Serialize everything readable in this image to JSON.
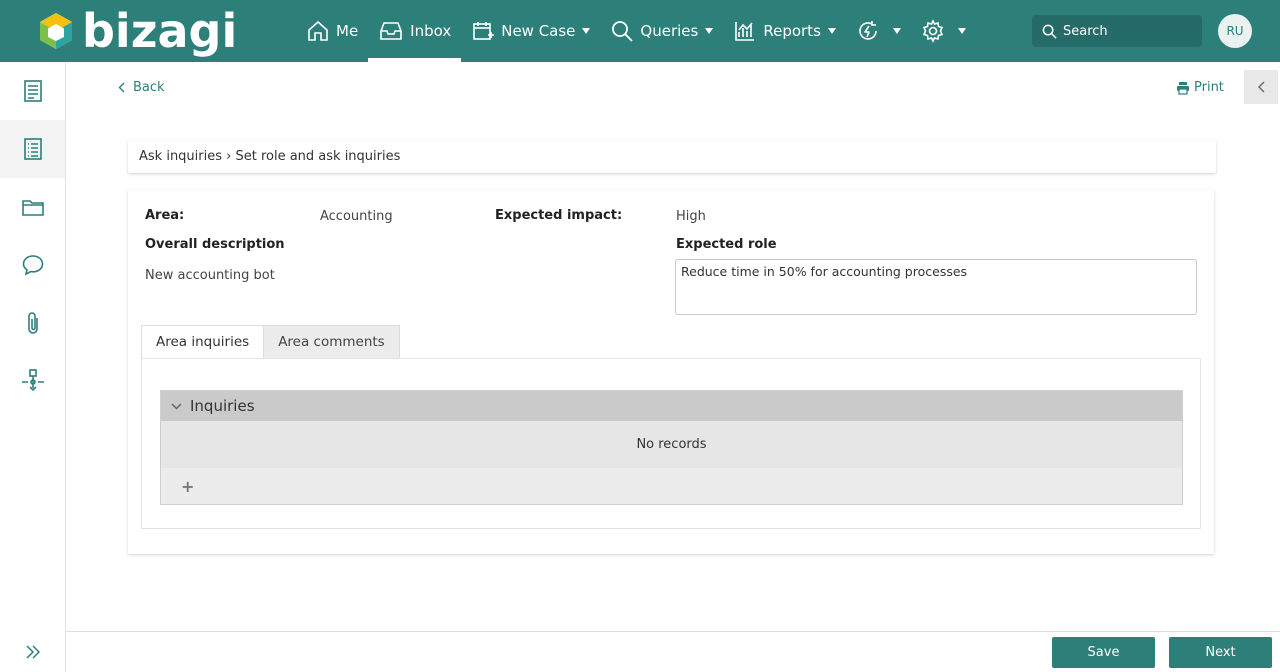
{
  "app": {
    "brand": "bizagi",
    "user_initials": "RU"
  },
  "nav": {
    "me": "Me",
    "inbox": "Inbox",
    "new_case": "New Case",
    "queries": "Queries",
    "reports": "Reports"
  },
  "search": {
    "placeholder": "Search"
  },
  "actions": {
    "back": "Back",
    "print": "Print"
  },
  "breadcrumb": "Ask inquiries › Set role and ask inquiries",
  "form": {
    "area_label": "Area:",
    "area_value": "Accounting",
    "impact_label": "Expected impact:",
    "impact_value": "High",
    "desc_label": "Overall description",
    "desc_value": "New accounting bot",
    "role_label": "Expected role",
    "role_value": "Reduce time in 50% for accounting processes"
  },
  "tabs": {
    "tab1": "Area inquiries",
    "tab2": "Area comments"
  },
  "grid": {
    "title": "Inquiries",
    "empty": "No records",
    "add": "+"
  },
  "buttons": {
    "save": "Save",
    "next": "Next"
  },
  "colors": {
    "primary": "#2d7f7a",
    "search_bg": "#256b67"
  }
}
